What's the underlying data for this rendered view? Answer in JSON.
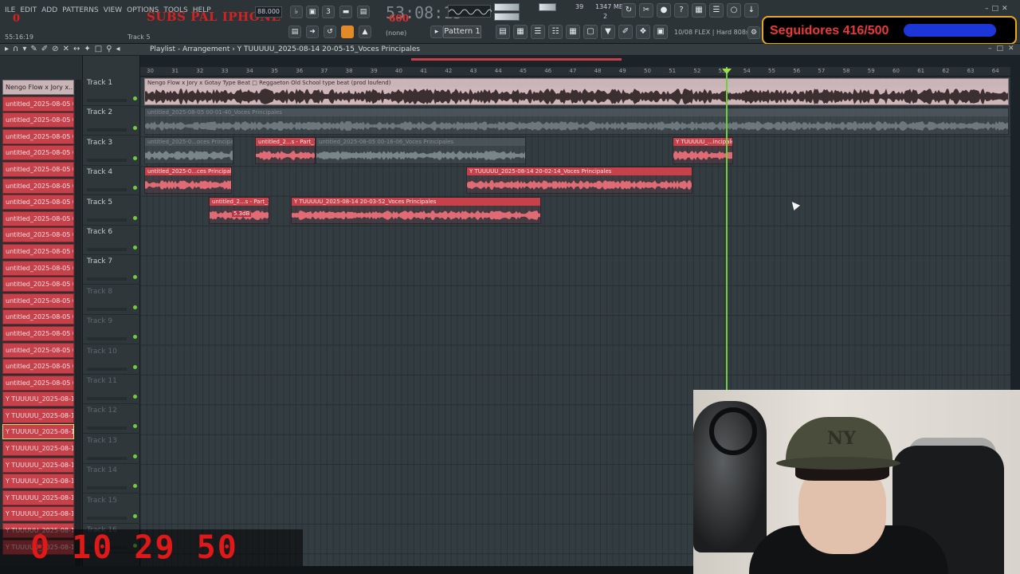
{
  "menu": [
    "ILE",
    "EDIT",
    "ADD",
    "PATTERNS",
    "VIEW",
    "OPTIONS",
    "TOOLS",
    "HELP"
  ],
  "overlay_title": "SUBS PAL IPHONE",
  "hint_zero": "0",
  "time_readout": "55:16:19",
  "track_readout": "Track 5",
  "big_time": "53:08:15",
  "big_time_small": "600",
  "tempo": "88.000",
  "pattern": "Pattern 1",
  "none_label": "(none)",
  "cpu": {
    "num": "39",
    "mem": "1347 MB",
    "two": "2"
  },
  "flex_info": "10/08  FLEX | Hard 808s",
  "followers": {
    "label": "Seguidores 416/500",
    "fill": 0.832,
    "bar_color": "#1d36d8"
  },
  "playlist": {
    "title": "Playlist - Arrangement  ›  Y TUUUUU_2025-08-14 20-05-15_Voces Principales"
  },
  "picker": [
    "Nengo Flow x Jory x...",
    "untitled_2025-08-05 00-...",
    "untitled_2025-08-05 00-...",
    "untitled_2025-08-05 00-...",
    "untitled_2025-08-05 00-...",
    "untitled_2025-08-05 00-...",
    "untitled_2025-08-05 00-...",
    "untitled_2025-08-05 00-...",
    "untitled_2025-08-05 00-...",
    "untitled_2025-08-05 00-...",
    "untitled_2025-08-05 00-...",
    "untitled_2025-08-05 00-...",
    "untitled_2025-08-05 00-...",
    "untitled_2025-08-05 00-...",
    "untitled_2025-08-05 00-...",
    "untitled_2025-08-05 00-...",
    "untitled_2025-08-05 00-...",
    "untitled_2025-08-05 00-...",
    "untitled_2025-08-05 00-...",
    "Y TUUUUU_2025-08-14 1...",
    "Y TUUUUU_2025-08-14 1...",
    "Y TUUUUU_2025-08-14 1...",
    "Y TUUUUU_2025-08-14 1...",
    "Y TUUUUU_2025-08-14 1...",
    "Y TUUUUU_2025-08-14 1...",
    "Y TUUUUU_2025-08-14 2...",
    "Y TUUUUU_2025-08-14 2...",
    "Y TUUUUU_2025-08-14 2...",
    "Y TUUUUU_2025-08-14 2..."
  ],
  "tracks": [
    "Track 1",
    "Track 2",
    "Track 3",
    "Track 4",
    "Track 5",
    "Track 6",
    "Track 7",
    "Track 8",
    "Track 9",
    "Track 10",
    "Track 11",
    "Track 12",
    "Track 13",
    "Track 14",
    "Track 15",
    "Track 16"
  ],
  "ruler": [
    "30",
    "31",
    "32",
    "33",
    "34",
    "35",
    "36",
    "37",
    "38",
    "39",
    "40",
    "41",
    "42",
    "43",
    "44",
    "45",
    "46",
    "47",
    "48",
    "49",
    "50",
    "51",
    "52",
    "53",
    "54",
    "55",
    "56",
    "57",
    "58",
    "59",
    "60",
    "61",
    "62",
    "63",
    "64"
  ],
  "clips": {
    "beat": "Nengo Flow x Jory x Gotay Type Beat □ Reggaeton Old School type beat (prod loufend)",
    "t2": "untitled_2025-08-05 00-01-40_Voces Principales",
    "t3a": "untitled_2025-0...oces Principales",
    "t3b": "untitled_2...s - Part_1",
    "t3c": "untitled_2025-08-05 00-16-06_Voces Principales",
    "t3d": "Y TUUUUU_...incipales",
    "t4a": "untitled_2025-0...ces Principales",
    "t4b": "Y TUUUUU_2025-08-14 20-02-14_Voces Principales",
    "t5a": "untitled_2...s - Part_1",
    "t5b": "Y TUUUUU_2025-08-14 20-03-52_Voces Principales",
    "gain": "5.3dB"
  },
  "counter": "0 10 29 50"
}
